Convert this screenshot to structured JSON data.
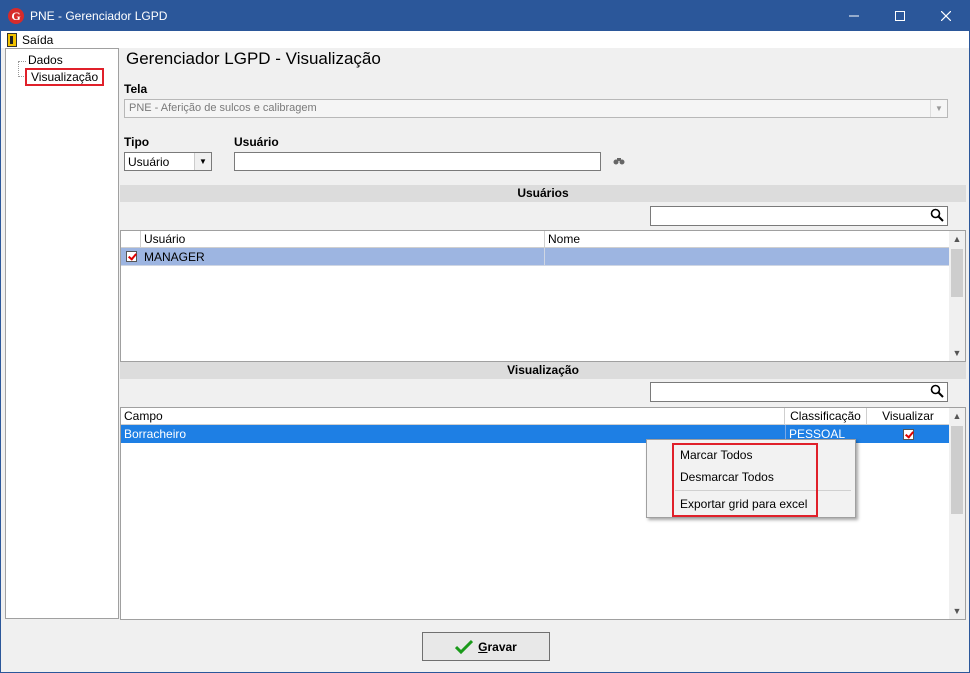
{
  "window": {
    "title": "PNE - Gerenciador LGPD"
  },
  "menu": {
    "exit_label": "Saída"
  },
  "tree": {
    "items": [
      {
        "label": "Dados"
      },
      {
        "label": "Visualização"
      }
    ]
  },
  "page": {
    "title": "Gerenciador LGPD - Visualização"
  },
  "form": {
    "tela_label": "Tela",
    "tela_value": "PNE - Aferição de sulcos e calibragem",
    "tipo_label": "Tipo",
    "tipo_value": "Usuário",
    "usuario_label": "Usuário",
    "usuario_value": ""
  },
  "users_section": {
    "title": "Usuários",
    "search_value": "",
    "columns": [
      "Usuário",
      "Nome"
    ],
    "rows": [
      {
        "checked": true,
        "usuario": "MANAGER",
        "nome": ""
      }
    ]
  },
  "vis_section": {
    "title": "Visualização",
    "search_value": "",
    "columns": [
      "Campo",
      "Classificação",
      "Visualizar"
    ],
    "rows": [
      {
        "campo": "Borracheiro",
        "classificacao": "PESSOAL",
        "visualizar": true
      }
    ]
  },
  "context_menu": {
    "items": [
      "Marcar Todos",
      "Desmarcar Todos",
      "Exportar grid para excel"
    ]
  },
  "footer": {
    "save_label_first": "G",
    "save_label_rest": "ravar"
  },
  "colors": {
    "titlebar": "#2b579a",
    "row_selected": "#1e7fe4",
    "row_user": "#9db5e1",
    "highlight": "#e0202a"
  }
}
